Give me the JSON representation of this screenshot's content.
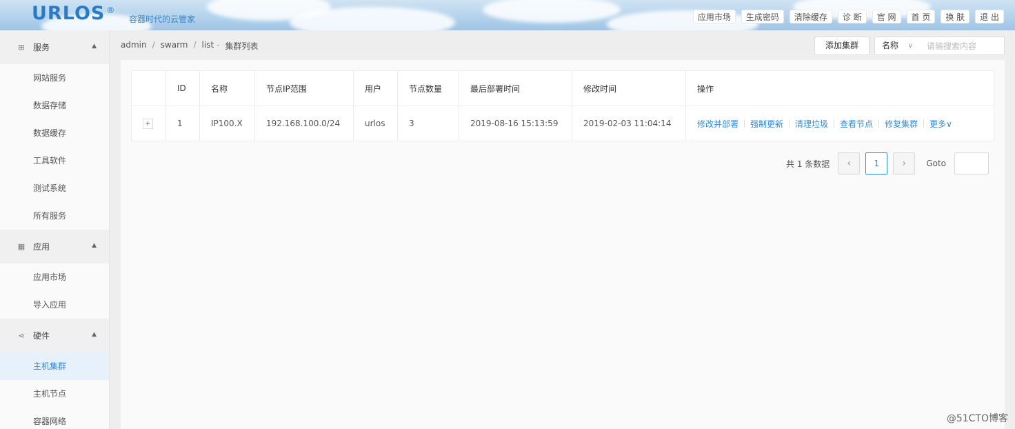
{
  "header": {
    "logo": "URLOS",
    "logo_mark": "®",
    "slogan": "容器时代的云管家",
    "nav": [
      "应用市场",
      "生成密码",
      "清除缓存",
      "诊 断",
      "官 网",
      "首 页",
      "换 肤",
      "退 出"
    ]
  },
  "sidebar": {
    "groups": [
      {
        "label": "服务",
        "icon": "grid-icon",
        "items": [
          "网站服务",
          "数据存储",
          "数据缓存",
          "工具软件",
          "测试系统",
          "所有服务"
        ]
      },
      {
        "label": "应用",
        "icon": "apps-icon",
        "items": [
          "应用市场",
          "导入应用"
        ]
      },
      {
        "label": "硬件",
        "icon": "share-nodes-icon",
        "items": [
          "主机集群",
          "主机节点",
          "容器网络"
        ]
      }
    ],
    "active_item": "主机集群"
  },
  "breadcrumb": [
    "admin",
    "swarm",
    "list",
    "集群列表"
  ],
  "toolbar": {
    "add_label": "添加集群",
    "search_field": "名称",
    "search_placeholder": "请输搜索内容"
  },
  "table": {
    "columns": [
      "",
      "ID",
      "名称",
      "节点IP范围",
      "用户",
      "节点数量",
      "最后部署时间",
      "修改时间",
      "操作"
    ],
    "rows": [
      {
        "expand": "+",
        "id": "1",
        "name": "IP100.X",
        "ip_range": "192.168.100.0/24",
        "user": "urlos",
        "nodes": "3",
        "last_deploy": "2019-08-16 15:13:59",
        "modified": "2019-02-03 11:04:14",
        "ops": [
          "修改并部署",
          "强制更新",
          "清理垃圾",
          "查看节点",
          "修复集群",
          "更多"
        ]
      }
    ]
  },
  "pagination": {
    "total_text": "共 1 条数据",
    "prev": "‹",
    "current": "1",
    "next": "›",
    "goto_label": "Goto"
  },
  "watermark": "@51CTO博客"
}
